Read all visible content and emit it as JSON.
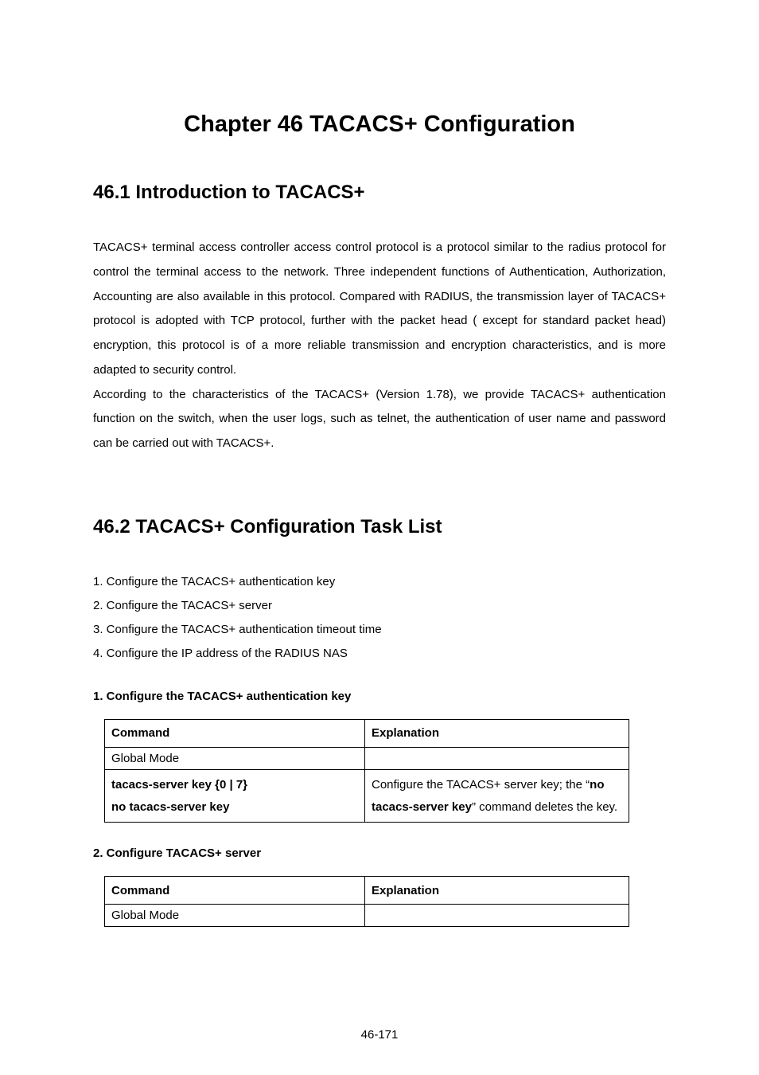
{
  "chapter_title": "Chapter 46 TACACS+ Configuration",
  "section1": {
    "heading": "46.1 Introduction to TACACS+",
    "para1": "TACACS+ terminal access controller access control protocol is a protocol similar to the radius protocol for control the terminal access to the network. Three independent functions of Authentication, Authorization, Accounting are also available in this protocol. Compared with RADIUS, the transmission layer of TACACS+ protocol is adopted with TCP protocol, further with the packet head ( except for standard packet head) encryption, this protocol is of a more reliable transmission and encryption characteristics, and is more adapted to security control.",
    "para2": "According to the characteristics of the TACACS+ (Version 1.78), we provide TACACS+ authentication function on the switch, when the user logs, such as telnet, the authentication of user name and password can be carried out with TACACS+."
  },
  "section2": {
    "heading": "46.2 TACACS+ Configuration Task List",
    "items": [
      "1. Configure the TACACS+ authentication key",
      "2. Configure the TACACS+ server",
      "3. Configure the TACACS+ authentication timeout time",
      "4. Configure the IP address of the RADIUS NAS"
    ],
    "table1": {
      "title": "1. Configure the TACACS+ authentication key",
      "header_left": "Command",
      "header_right": "Explanation",
      "mode_row": "Global Mode",
      "cmd_line1": "tacacs-server key {0 | 7}",
      "cmd_line2": "no tacacs-server key",
      "expl_pre": "Configure the TACACS+ server key; the “",
      "expl_bold": "no tacacs-server key",
      "expl_post": "” command deletes the key."
    },
    "table2": {
      "title": "2. Configure TACACS+ server",
      "header_left": "Command",
      "header_right": "Explanation",
      "mode_row": "Global Mode"
    }
  },
  "footer": "46-171"
}
